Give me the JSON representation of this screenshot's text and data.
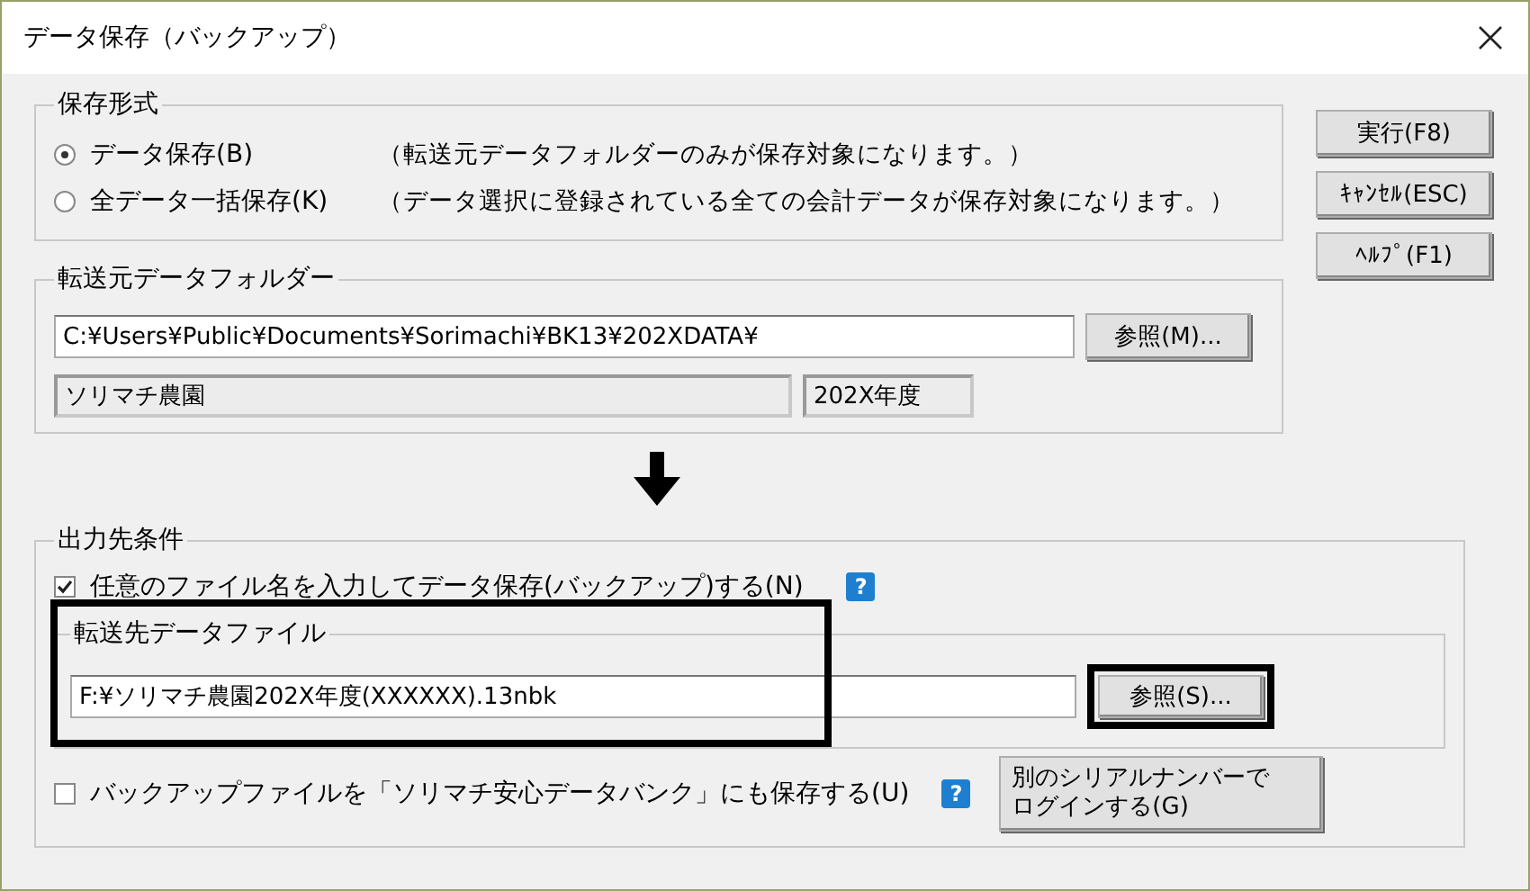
{
  "window": {
    "title": "データ保存（バックアップ）"
  },
  "save_format": {
    "title": "保存形式",
    "options": [
      {
        "label": "データ保存(B)",
        "note": "（転送元データフォルダーのみが保存対象になります。）",
        "selected": true
      },
      {
        "label": "全データ一括保存(K)",
        "note": "（データ選択に登録されている全ての会計データが保存対象になります。）",
        "selected": false
      }
    ]
  },
  "buttons": [
    "実行(F8)",
    "ｷｬﾝｾﾙ(ESC)",
    "ﾍﾙﾌﾟ(F1)"
  ],
  "source": {
    "title": "転送元データフォルダー",
    "path": "C:¥Users¥Public¥Documents¥Sorimachi¥BK13¥202XDATA¥",
    "browse": "参照(M)...",
    "company": "ソリマチ農園",
    "year": "202X年度"
  },
  "output": {
    "title": "出力先条件",
    "custom_name": {
      "label": "任意のファイル名を入力してデータ保存(バックアップ)する(N)",
      "checked": true,
      "help": "?"
    },
    "dest": {
      "title": "転送先データファイル",
      "path": "F:¥ソリマチ農園202X年度(XXXXXX).13nbk",
      "browse": "参照(S)...",
      "highlighted": true,
      "browse_highlighted": true
    },
    "data_bank": {
      "label": "バックアップファイルを「ソリマチ安心データバンク」にも保存する(U)",
      "checked": false,
      "help": "?"
    },
    "login": "別のシリアルナンバーでログインする(G)"
  }
}
